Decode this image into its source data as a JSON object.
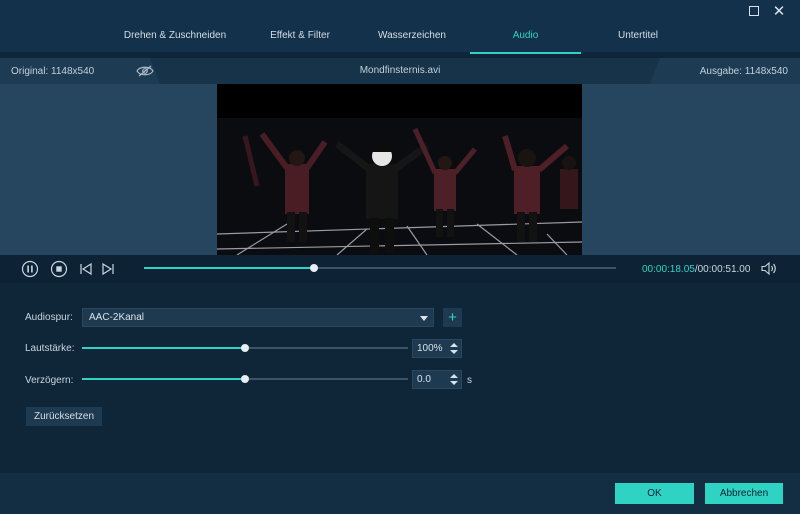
{
  "tabs": [
    {
      "label": "Drehen & Zuschneiden",
      "active": false
    },
    {
      "label": "Effekt & Filter",
      "active": false
    },
    {
      "label": "Wasserzeichen",
      "active": false
    },
    {
      "label": "Audio",
      "active": true
    },
    {
      "label": "Untertitel",
      "active": false
    }
  ],
  "infobar": {
    "original": "Original: 1148x540",
    "filename": "Mondfinsternis.avi",
    "output": "Ausgabe: 1148x540"
  },
  "player": {
    "progress": 0.36,
    "current_time": "00:00:18.05",
    "total_time": "/00:00:51.00"
  },
  "audio": {
    "track_label": "Audiospur:",
    "track_value": "AAC-2Kanal",
    "volume_label": "Lautstärke:",
    "volume_value": "100%",
    "volume_level": 0.5,
    "delay_label": "Verzögern:",
    "delay_value": "0.0",
    "delay_level": 0.5,
    "delay_unit": "s",
    "reset_label": "Zurücksetzen"
  },
  "footer": {
    "ok_label": "OK",
    "cancel_label": "Abbrechen"
  },
  "colors": {
    "accent": "#2ed3c3",
    "background": "#0f2639",
    "stage": "#264660"
  }
}
